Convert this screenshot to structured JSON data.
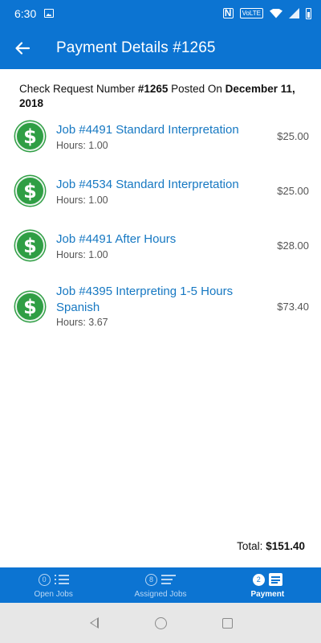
{
  "status_bar": {
    "time": "6:30",
    "volte": "VoLTE",
    "icons": [
      "image-icon",
      "nfc-icon",
      "volte-icon",
      "wifi-icon",
      "signal-icon",
      "battery-icon"
    ]
  },
  "app_bar": {
    "title": "Payment Details #1265",
    "back_icon": "arrow-left-icon"
  },
  "request": {
    "prefix": "Check Request Number ",
    "number": "#1265",
    "middle": " Posted On ",
    "date": "December 11, 2018"
  },
  "payments": [
    {
      "title": "Job #4491 Standard Interpretation",
      "hours": "Hours: 1.00",
      "amount": "$25.00",
      "icon": "dollar-icon"
    },
    {
      "title": "Job #4534 Standard Interpretation",
      "hours": "Hours: 1.00",
      "amount": "$25.00",
      "icon": "dollar-icon"
    },
    {
      "title": "Job #4491 After Hours",
      "hours": "Hours: 1.00",
      "amount": "$28.00",
      "icon": "dollar-icon"
    },
    {
      "title": "Job #4395 Interpreting 1-5 Hours Spanish",
      "hours": "Hours: 3.67",
      "amount": "$73.40",
      "icon": "dollar-icon"
    }
  ],
  "total": {
    "label": "Total: ",
    "value": "$151.40"
  },
  "bottom_nav": {
    "tabs": [
      {
        "label": "Open Jobs",
        "count": "0",
        "icon": "bulleted-list-icon",
        "active": false
      },
      {
        "label": "Assigned Jobs",
        "count": "8",
        "icon": "lines-list-icon",
        "active": false
      },
      {
        "label": "Payment",
        "count": "2",
        "icon": "document-icon",
        "active": true
      }
    ]
  },
  "system_nav": {
    "icons": [
      "back-triangle-icon",
      "home-circle-icon",
      "recents-square-icon"
    ]
  },
  "colors": {
    "primary": "#0c74d2",
    "link": "#1678c2",
    "dollar_green": "#2f9e44"
  }
}
